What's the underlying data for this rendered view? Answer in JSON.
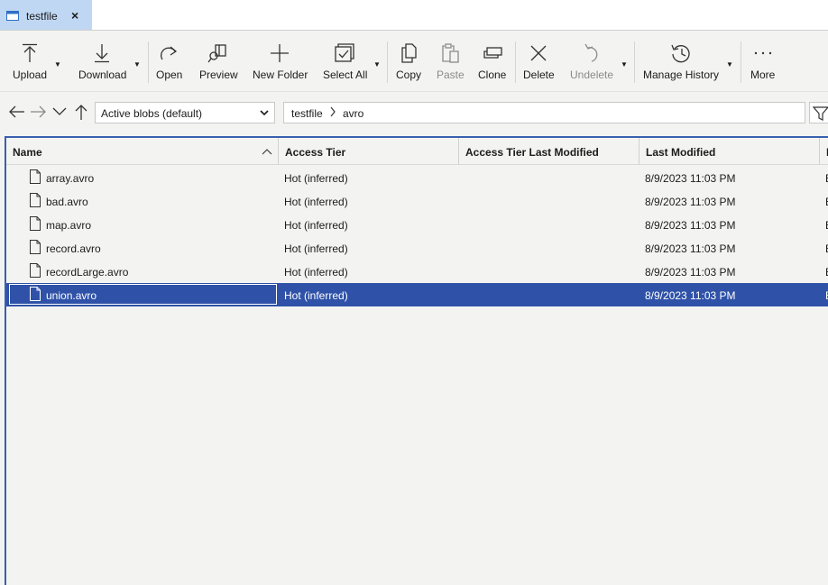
{
  "tab": {
    "title": "testfile",
    "close": "×"
  },
  "toolbar": {
    "upload": "Upload",
    "download": "Download",
    "open": "Open",
    "preview": "Preview",
    "new_folder": "New Folder",
    "select_all": "Select All",
    "copy": "Copy",
    "paste": "Paste",
    "clone": "Clone",
    "delete": "Delete",
    "undelete": "Undelete",
    "manage_history": "Manage History",
    "more": "More"
  },
  "nav": {
    "view_select": "Active blobs (default)",
    "breadcrumb": [
      "testfile",
      "avro"
    ]
  },
  "grid": {
    "columns": [
      "Name",
      "Access Tier",
      "Access Tier Last Modified",
      "Last Modified"
    ],
    "rows": [
      {
        "name": "array.avro",
        "access_tier": "Hot (inferred)",
        "tier_modified": "",
        "last_modified": "8/9/2023 11:03 PM",
        "extra": "B"
      },
      {
        "name": "bad.avro",
        "access_tier": "Hot (inferred)",
        "tier_modified": "",
        "last_modified": "8/9/2023 11:03 PM",
        "extra": "B"
      },
      {
        "name": "map.avro",
        "access_tier": "Hot (inferred)",
        "tier_modified": "",
        "last_modified": "8/9/2023 11:03 PM",
        "extra": "B"
      },
      {
        "name": "record.avro",
        "access_tier": "Hot (inferred)",
        "tier_modified": "",
        "last_modified": "8/9/2023 11:03 PM",
        "extra": "B"
      },
      {
        "name": "recordLarge.avro",
        "access_tier": "Hot (inferred)",
        "tier_modified": "",
        "last_modified": "8/9/2023 11:03 PM",
        "extra": "B"
      },
      {
        "name": "union.avro",
        "access_tier": "Hot (inferred)",
        "tier_modified": "",
        "last_modified": "8/9/2023 11:03 PM",
        "extra": "B"
      }
    ],
    "selected_index": 5
  },
  "colors": {
    "accent": "#2f52a8",
    "tab_active": "#bfd7f2",
    "background": "#f3f4f2"
  }
}
